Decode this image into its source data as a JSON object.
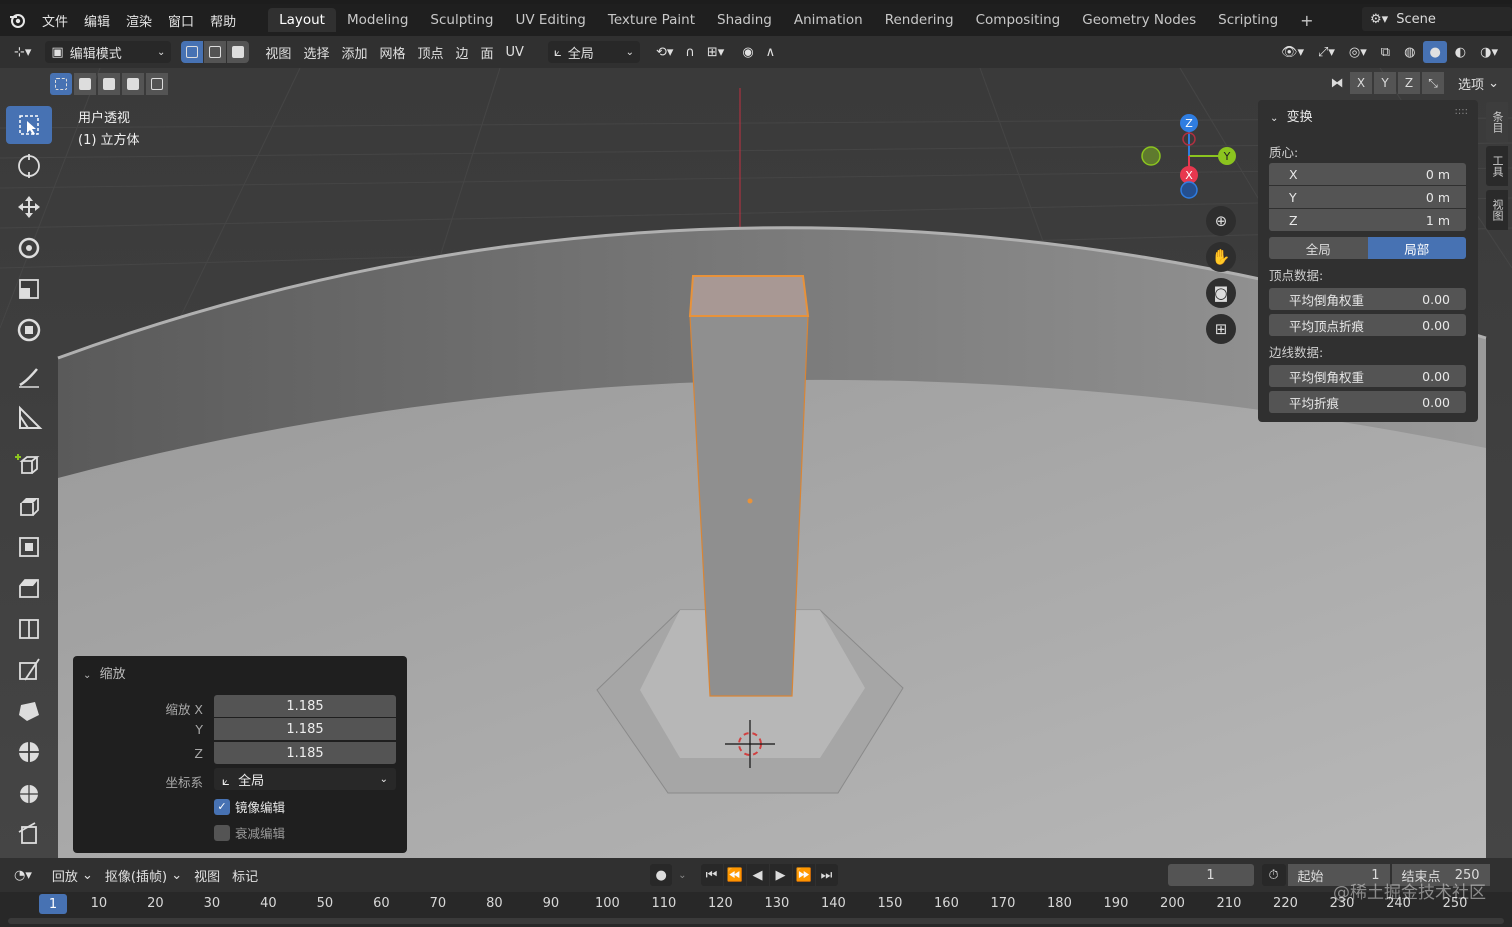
{
  "menu": {
    "file": "文件",
    "edit": "编辑",
    "render": "渲染",
    "window": "窗口",
    "help": "帮助"
  },
  "workspaces": [
    "Layout",
    "Modeling",
    "Sculpting",
    "UV Editing",
    "Texture Paint",
    "Shading",
    "Animation",
    "Rendering",
    "Compositing",
    "Geometry Nodes",
    "Scripting"
  ],
  "scene": {
    "label": "Scene"
  },
  "header": {
    "mode": "编辑模式",
    "view": "视图",
    "select": "选择",
    "add": "添加",
    "mesh": "网格",
    "vertex": "顶点",
    "edge": "边",
    "face": "面",
    "uv": "UV",
    "orientation": "全局",
    "axes": [
      "X",
      "Y",
      "Z"
    ],
    "options": "选项"
  },
  "viewport": {
    "view_name": "用户透视",
    "object_name": "(1) 立方体"
  },
  "gizmo": {
    "z": "Z",
    "y": "Y",
    "x": "X"
  },
  "npanel": {
    "title": "变换",
    "median": "质心:",
    "x_label": "X",
    "x_value": "0 m",
    "y_label": "Y",
    "y_value": "0 m",
    "z_label": "Z",
    "z_value": "1 m",
    "global": "全局",
    "local": "局部",
    "vertex_data": "顶点数据:",
    "v_bevel": "平均倒角权重",
    "v_bevel_value": "0.00",
    "v_crease": "平均顶点折痕",
    "v_crease_value": "0.00",
    "edge_data": "边线数据:",
    "e_bevel": "平均倒角权重",
    "e_bevel_value": "0.00",
    "e_crease": "平均折痕",
    "e_crease_value": "0.00",
    "tabs": [
      "条目",
      "工具",
      "视图"
    ]
  },
  "operator": {
    "title": "缩放",
    "scale_x_label": "缩放 X",
    "scale_x": "1.185",
    "y_label": "Y",
    "scale_y": "1.185",
    "z_label": "Z",
    "scale_z": "1.185",
    "orient_label": "坐标系",
    "orient_value": "全局",
    "mirror_label": "镜像编辑",
    "mirror_checked": true,
    "falloff_label": "衰减编辑",
    "falloff_checked": false
  },
  "timeline": {
    "playback": "回放",
    "keying": "抠像(插帧)",
    "view": "视图",
    "marker": "标记",
    "current_frame": "1",
    "start_label": "起始",
    "start_value": "1",
    "end_label": "结束点",
    "end_value": "250",
    "ticks": [
      "1",
      "10",
      "20",
      "30",
      "40",
      "50",
      "60",
      "70",
      "80",
      "90",
      "100",
      "110",
      "120",
      "130",
      "140",
      "150",
      "160",
      "170",
      "180",
      "190",
      "200",
      "210",
      "220",
      "230",
      "240",
      "250"
    ]
  },
  "watermark": "@稀土掘金技术社区",
  "colors": {
    "accent": "#4772b3",
    "selection": "#e8923a",
    "x_axis": "#e8384f",
    "y_axis": "#8bc41f",
    "z_axis": "#2f7de1"
  }
}
